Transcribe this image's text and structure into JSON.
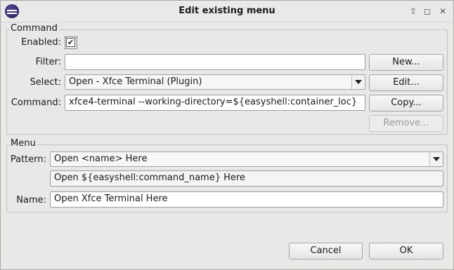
{
  "window": {
    "title": "Edit existing menu",
    "controls": [
      "window-up-icon",
      "maximize-icon",
      "close-icon"
    ]
  },
  "command_group": {
    "label": "Command",
    "enabled_label": "Enabled:",
    "enabled_checked": true,
    "filter_label": "Filter:",
    "filter_value": "",
    "select_label": "Select:",
    "select_value": "Open - Xfce Terminal (Plugin)",
    "command_label": "Command:",
    "command_value": "xfce4-terminal --working-directory=${easyshell:container_loc}",
    "buttons": {
      "new": "New...",
      "edit": "Edit...",
      "copy": "Copy...",
      "remove": "Remove..."
    }
  },
  "menu_group": {
    "label": "Menu",
    "pattern_label": "Pattern:",
    "pattern_value": "Open <name> Here",
    "pattern_expansion": "Open ${easyshell:command_name} Here",
    "name_label": "Name:",
    "name_value": "Open Xfce Terminal Here"
  },
  "footer": {
    "cancel": "Cancel",
    "ok": "OK"
  }
}
